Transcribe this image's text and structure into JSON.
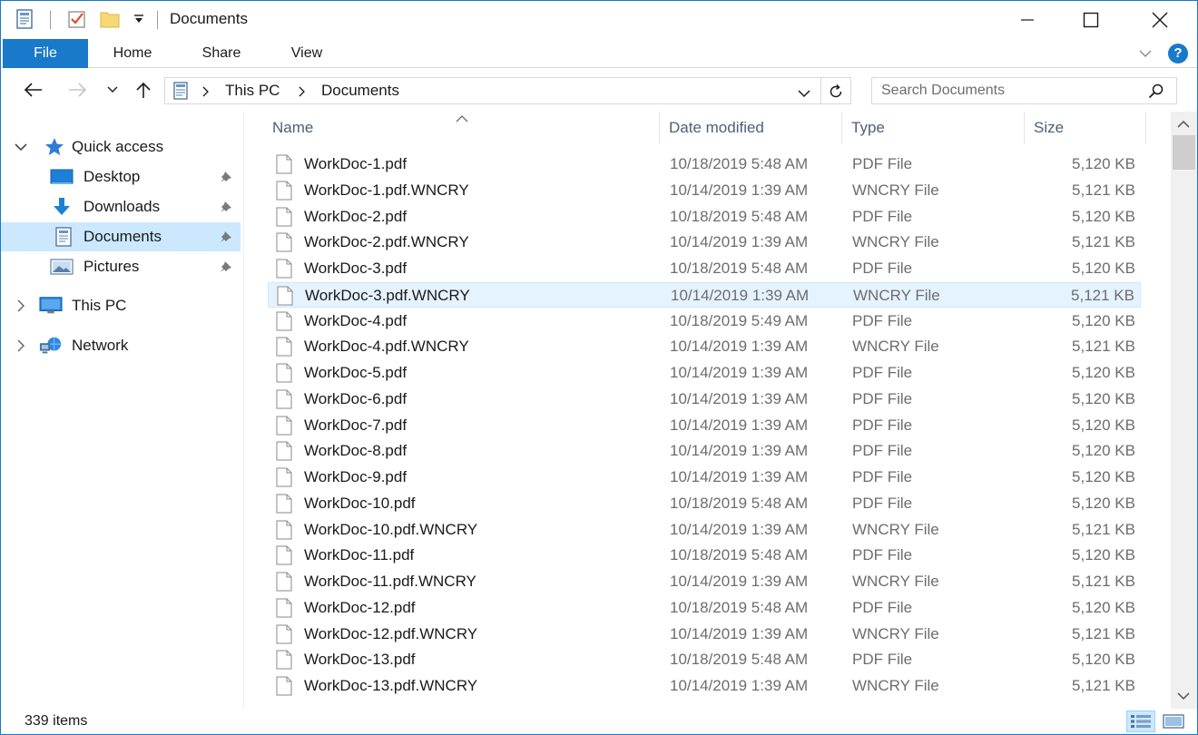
{
  "window": {
    "title": "Documents",
    "accent_color": "#1979ca",
    "selected_bg": "#cce8ff"
  },
  "ribbon": {
    "tabs": [
      {
        "label": "File"
      },
      {
        "label": "Home"
      },
      {
        "label": "Share"
      },
      {
        "label": "View"
      }
    ],
    "help_label": "?"
  },
  "address_bar": {
    "breadcrumb": [
      "This PC",
      "Documents"
    ]
  },
  "search": {
    "placeholder": "Search Documents"
  },
  "sidebar": {
    "items": [
      {
        "label": "Quick access",
        "icon": "star-icon"
      },
      {
        "label": "Desktop",
        "icon": "desktop-folder-icon",
        "pinned": true
      },
      {
        "label": "Downloads",
        "icon": "downloads-arrow-icon",
        "pinned": true
      },
      {
        "label": "Documents",
        "icon": "documents-icon",
        "pinned": true,
        "selected": true
      },
      {
        "label": "Pictures",
        "icon": "pictures-icon",
        "pinned": true
      },
      {
        "label": "This PC",
        "icon": "computer-icon"
      },
      {
        "label": "Network",
        "icon": "network-icon"
      }
    ]
  },
  "file_list": {
    "columns": [
      "Name",
      "Date modified",
      "Type",
      "Size"
    ],
    "rows": [
      {
        "name": "WorkDoc-1.pdf",
        "date": "10/18/2019 5:48 AM",
        "type": "PDF File",
        "size": "5,120 KB"
      },
      {
        "name": "WorkDoc-1.pdf.WNCRY",
        "date": "10/14/2019 1:39 AM",
        "type": "WNCRY File",
        "size": "5,121 KB"
      },
      {
        "name": "WorkDoc-2.pdf",
        "date": "10/18/2019 5:48 AM",
        "type": "PDF File",
        "size": "5,120 KB"
      },
      {
        "name": "WorkDoc-2.pdf.WNCRY",
        "date": "10/14/2019 1:39 AM",
        "type": "WNCRY File",
        "size": "5,121 KB"
      },
      {
        "name": "WorkDoc-3.pdf",
        "date": "10/18/2019 5:48 AM",
        "type": "PDF File",
        "size": "5,120 KB"
      },
      {
        "name": "WorkDoc-3.pdf.WNCRY",
        "date": "10/14/2019 1:39 AM",
        "type": "WNCRY File",
        "size": "5,121 KB",
        "hover": true
      },
      {
        "name": "WorkDoc-4.pdf",
        "date": "10/18/2019 5:49 AM",
        "type": "PDF File",
        "size": "5,120 KB"
      },
      {
        "name": "WorkDoc-4.pdf.WNCRY",
        "date": "10/14/2019 1:39 AM",
        "type": "WNCRY File",
        "size": "5,121 KB"
      },
      {
        "name": "WorkDoc-5.pdf",
        "date": "10/14/2019 1:39 AM",
        "type": "PDF File",
        "size": "5,120 KB"
      },
      {
        "name": "WorkDoc-6.pdf",
        "date": "10/14/2019 1:39 AM",
        "type": "PDF File",
        "size": "5,120 KB"
      },
      {
        "name": "WorkDoc-7.pdf",
        "date": "10/14/2019 1:39 AM",
        "type": "PDF File",
        "size": "5,120 KB"
      },
      {
        "name": "WorkDoc-8.pdf",
        "date": "10/14/2019 1:39 AM",
        "type": "PDF File",
        "size": "5,120 KB"
      },
      {
        "name": "WorkDoc-9.pdf",
        "date": "10/14/2019 1:39 AM",
        "type": "PDF File",
        "size": "5,120 KB"
      },
      {
        "name": "WorkDoc-10.pdf",
        "date": "10/18/2019 5:48 AM",
        "type": "PDF File",
        "size": "5,120 KB"
      },
      {
        "name": "WorkDoc-10.pdf.WNCRY",
        "date": "10/14/2019 1:39 AM",
        "type": "WNCRY File",
        "size": "5,121 KB"
      },
      {
        "name": "WorkDoc-11.pdf",
        "date": "10/18/2019 5:48 AM",
        "type": "PDF File",
        "size": "5,120 KB"
      },
      {
        "name": "WorkDoc-11.pdf.WNCRY",
        "date": "10/14/2019 1:39 AM",
        "type": "WNCRY File",
        "size": "5,121 KB"
      },
      {
        "name": "WorkDoc-12.pdf",
        "date": "10/18/2019 5:48 AM",
        "type": "PDF File",
        "size": "5,120 KB"
      },
      {
        "name": "WorkDoc-12.pdf.WNCRY",
        "date": "10/14/2019 1:39 AM",
        "type": "WNCRY File",
        "size": "5,121 KB"
      },
      {
        "name": "WorkDoc-13.pdf",
        "date": "10/18/2019 5:48 AM",
        "type": "PDF File",
        "size": "5,120 KB"
      },
      {
        "name": "WorkDoc-13.pdf.WNCRY",
        "date": "10/14/2019 1:39 AM",
        "type": "WNCRY File",
        "size": "5,121 KB"
      }
    ]
  },
  "status_bar": {
    "item_count": "339 items"
  }
}
